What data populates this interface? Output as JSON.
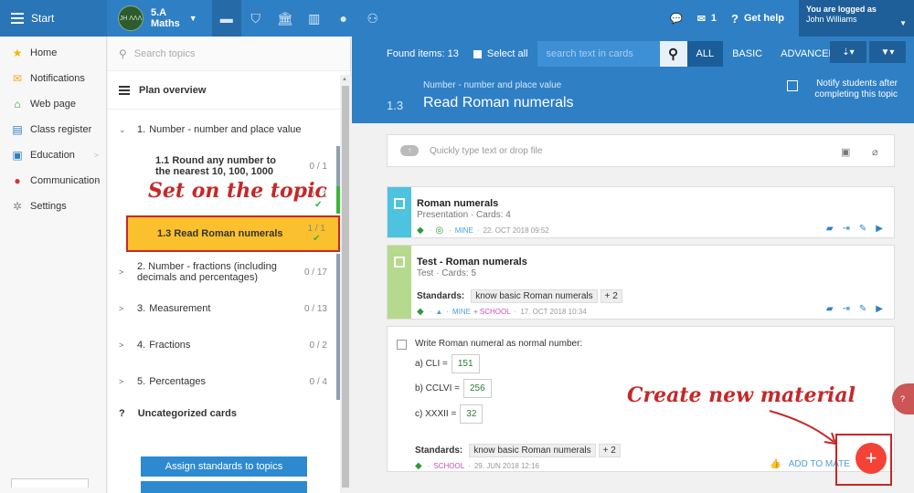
{
  "topbar": {
    "start_label": "Start",
    "class_name": "5.A",
    "class_subject": "Maths",
    "avatar_text": "JH ΛΛΛ",
    "messages_count": "1",
    "help_label": "Get help",
    "logged_as": "You are logged as",
    "user_name": "John Williams"
  },
  "sidebar": {
    "items": [
      {
        "label": "Home",
        "icon": "star-icon",
        "color": "#f5b400"
      },
      {
        "label": "Notifications",
        "icon": "envelope-icon",
        "color": "#f5a623"
      },
      {
        "label": "Web page",
        "icon": "house-icon",
        "color": "#2e9a3a"
      },
      {
        "label": "Class register",
        "icon": "register-icon",
        "color": "#2f7fc4"
      },
      {
        "label": "Education",
        "icon": "book-icon",
        "color": "#2f7fc4"
      },
      {
        "label": "Communication",
        "icon": "chat-icon",
        "color": "#d9342b"
      },
      {
        "label": "Settings",
        "icon": "gear-icon",
        "color": "#888888"
      }
    ]
  },
  "topics": {
    "search_placeholder": "Search topics",
    "plan_label": "Plan overview",
    "rows": [
      {
        "num": "1.",
        "label": "Number - number and place value",
        "count": ""
      },
      {
        "num": "2.",
        "label": "Number - fractions (including decimals and percentages)",
        "count": "0 / 17"
      },
      {
        "num": "3.",
        "label": "Measurement",
        "count": "0 / 13"
      },
      {
        "num": "4.",
        "label": "Fractions",
        "count": "0 / 2"
      },
      {
        "num": "5.",
        "label": "Percentages",
        "count": "0 / 4"
      }
    ],
    "subtopics": [
      {
        "label": "1.1 Round any number to the nearest 10, 100, 1000",
        "count": "0 / 1"
      },
      {
        "label": "",
        "count": "0 / 1"
      },
      {
        "label": "1.3 Read Roman numerals",
        "count": "1 / 1"
      }
    ],
    "uncat_mark": "?",
    "uncat_label": "Uncategorized cards",
    "assign_label": "Assign standards to topics"
  },
  "annotations": {
    "set_topic": "Set on the topic",
    "create_material": "Create new material"
  },
  "main": {
    "found_items": "Found items: 13",
    "select_all": "Select all",
    "search_placeholder": "search text in cards",
    "tabs": [
      "ALL",
      "BASIC",
      "ADVANCED"
    ],
    "breadcrumb": "Number - number and place value",
    "topic_num": "1.3",
    "topic_title": "Read Roman numerals",
    "notify_line1": "Notify students after",
    "notify_line2": "completing this topic",
    "quick_placeholder": "Quickly type text or drop file",
    "card1": {
      "title": "Roman numerals",
      "subtitle": "Presentation · Cards: 4",
      "owner": "MINE",
      "date": "22. OCT 2018 09:52"
    },
    "card2": {
      "title": "Test - Roman numerals",
      "subtitle": "Test · Cards: 5",
      "standards_label": "Standards:",
      "standard": "know basic Roman numerals",
      "more": "+ 2",
      "owner": "MINE",
      "owner2": "+ SCHOOL",
      "date": "17. OCT 2018 10:34"
    },
    "card3": {
      "question": "Write Roman numeral as normal number:",
      "a_label": "a) CLI =",
      "a_value": "151",
      "b_label": "b) CCLVI =",
      "b_value": "256",
      "c_label": "c) XXXII =",
      "c_value": "32",
      "standards_label": "Standards:",
      "standard": "know basic Roman numerals",
      "more": "+ 2",
      "owner": "SCHOOL",
      "date": "29. JUN 2018 12:16",
      "add_label": "ADD TO MATE"
    },
    "fab_label": "+"
  }
}
